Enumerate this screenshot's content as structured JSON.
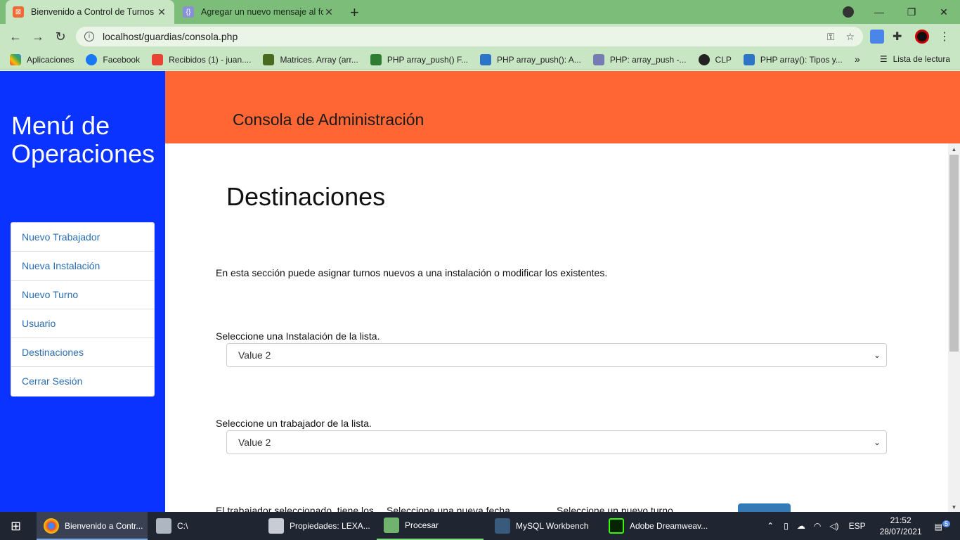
{
  "browser": {
    "tabs": [
      {
        "title": "Bienvenido a Control de Turnos"
      },
      {
        "title": "Agregar un nuevo mensaje al for"
      }
    ],
    "url": "localhost/guardias/consola.php",
    "bookmarks": [
      {
        "label": "Aplicaciones",
        "icon": "apps-grid-icon"
      },
      {
        "label": "Facebook",
        "icon": "facebook-icon"
      },
      {
        "label": "Recibidos (1) - juan....",
        "icon": "gmail-icon"
      },
      {
        "label": "Matrices. Array (arr...",
        "icon": "apr-icon"
      },
      {
        "label": "PHP array_push() F...",
        "icon": "w3-icon"
      },
      {
        "label": "PHP array_push(): A...",
        "icon": "shield-icon"
      },
      {
        "label": "PHP: array_push -...",
        "icon": "php-icon"
      },
      {
        "label": "CLP",
        "icon": "globe-icon"
      },
      {
        "label": "PHP array(): Tipos y...",
        "icon": "shield-icon"
      }
    ],
    "reading_list": "Lista de lectura"
  },
  "sidebar": {
    "title_line1": "Menú de",
    "title_line2": "Operaciones",
    "items": [
      {
        "label": "Nuevo Trabajador"
      },
      {
        "label": "Nueva Instalación"
      },
      {
        "label": "Nuevo Turno"
      },
      {
        "label": "Usuario"
      },
      {
        "label": "Destinaciones"
      },
      {
        "label": "Cerrar Sesión"
      }
    ]
  },
  "header": {
    "title": "Consola de Administración"
  },
  "main": {
    "title": "Destinaciones",
    "intro": "En esta sección puede asignar turnos nuevos a una instalación o modificar los existentes.",
    "installation_label": "Seleccione una Instalación de la lista.",
    "installation_value": "Value 2",
    "worker_label": "Seleccione un trabajador de la lista.",
    "worker_value": "Value 2",
    "partial_text_1": "El trabajador seleccionado, tiene los",
    "partial_text_2": "Seleccione una nueva fecha",
    "partial_text_3": "Seleccione un nuevo turno"
  },
  "taskbar": {
    "items": [
      {
        "label": "Bienvenido a Contr..."
      },
      {
        "label": "C:\\"
      },
      {
        "label": "Propiedades: LEXA..."
      },
      {
        "label": "Procesar"
      },
      {
        "label": "MySQL Workbench"
      },
      {
        "label": "Adobe Dreamweav..."
      }
    ],
    "language": "ESP",
    "time": "21:52",
    "date": "28/07/2021",
    "notifications": "5"
  },
  "colors": {
    "sidebar": "#0a33ff",
    "header": "#ff6633",
    "chrome": "#7dbd7a",
    "link": "#2a6db0"
  }
}
